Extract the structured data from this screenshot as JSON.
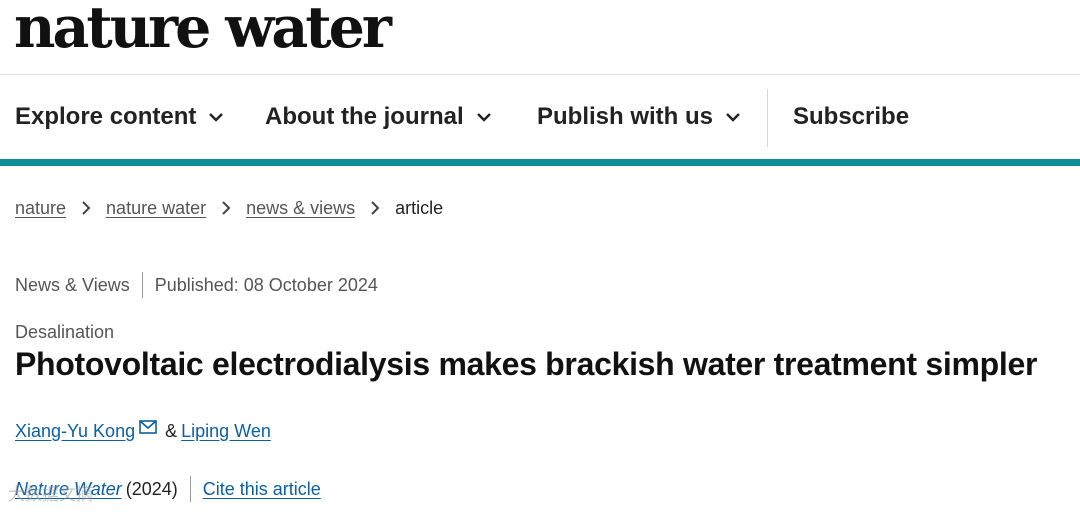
{
  "header": {
    "logo": "nature water"
  },
  "nav": {
    "items": [
      {
        "label": "Explore content",
        "icon": "chevron-down-icon"
      },
      {
        "label": "About the journal",
        "icon": "chevron-down-icon"
      },
      {
        "label": "Publish with us",
        "icon": "chevron-down-icon"
      }
    ],
    "subscribe": "Subscribe"
  },
  "colors": {
    "accent_bar": "#0e8e94",
    "link": "#0b5fa5"
  },
  "breadcrumb": {
    "items": [
      "nature",
      "nature water",
      "news & views"
    ],
    "current": "article",
    "separator_icon": "chevron-right-icon"
  },
  "article": {
    "type": "News & Views",
    "published": "Published: 08 October 2024",
    "subject": "Desalination",
    "title": "Photovoltaic electrodialysis makes brackish water treatment simpler",
    "authors": [
      "Xiang-Yu Kong",
      "Liping Wen"
    ],
    "author_separator": "&",
    "journal": "Nature Water",
    "year": "(2024)",
    "cite_label": "Cite this article"
  },
  "watermark": "大数据文摘"
}
